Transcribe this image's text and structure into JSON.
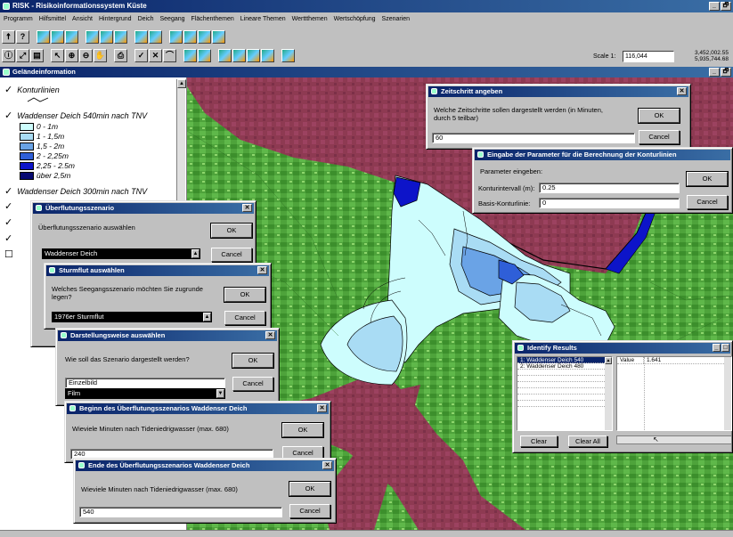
{
  "app": {
    "title": "RISK - Risikoinformationssystem Küste",
    "window_buttons": [
      "_",
      "🗗"
    ]
  },
  "menu": [
    "Programm",
    "Hilfsmittel",
    "Ansicht",
    "Hintergrund",
    "Deich",
    "Seegang",
    "Flächenthemen",
    "Lineare Themen",
    "Werttthemen",
    "Wertschöpfung",
    "Szenarien"
  ],
  "toolbar": {
    "scale_label": "Scale 1:",
    "scale_value": "116,044",
    "coord_x": "3,452,002.55",
    "coord_y": "5,935,744.68"
  },
  "subwindow": {
    "title": "Geländeinformation",
    "buttons": [
      "_",
      "🗗"
    ]
  },
  "legend": {
    "layer1": "Konturlinien",
    "layer2": "Waddenser Deich 540min nach TNV",
    "items": [
      {
        "label": "0 - 1m",
        "color": "#cdfdfd"
      },
      {
        "label": "1 - 1,5m",
        "color": "#a9dcf4"
      },
      {
        "label": "1,5 - 2m",
        "color": "#6aa3e6"
      },
      {
        "label": "2 - 2,25m",
        "color": "#2f5fd8"
      },
      {
        "label": "2,25 - 2.5m",
        "color": "#0d14c9"
      },
      {
        "label": "über 2,5m",
        "color": "#080a72"
      }
    ],
    "layer3": "Waddenser Deich 300min nach TNV"
  },
  "dialogs": {
    "zeitschritt": {
      "title": "Zeitschritt angeben",
      "text": "Welche Zeitschritte sollen dargestellt werden (in Minuten, durch 5 teilbar)",
      "value": "60",
      "ok": "OK",
      "cancel": "Cancel"
    },
    "konturparam": {
      "title": "Eingabe der Parameter für die Berechnung der Konturlinien",
      "text": "Parameter eingeben:",
      "label1": "Konturintervall (m):",
      "value1": "0.25",
      "label2": "Basis-Konturlinie:",
      "value2": "0",
      "ok": "OK",
      "cancel": "Cancel"
    },
    "ueberflutung": {
      "title": "Überflutungsszenario",
      "text": "Überflutungsszenario auswählen",
      "value": "Waddenser Deich",
      "ok": "OK",
      "cancel": "Cancel"
    },
    "sturmflut": {
      "title": "Sturmflut auswählen",
      "text": "Welches Seegangsszenario möchten Sie zugrunde legen?",
      "value": "1976er Sturmflut",
      "ok": "OK",
      "cancel": "Cancel"
    },
    "darstellung": {
      "title": "Darstellungsweise auswählen",
      "text": "Wie soll das Szenario dargestellt werden?",
      "value": "Einzelbild",
      "option": "Film",
      "ok": "OK",
      "cancel": "Cancel"
    },
    "beginn": {
      "title": "Beginn des Überflutungsszenarios Waddenser Deich",
      "text": "Wieviele Minuten nach Tideniedrigwasser (max. 680)",
      "value": "240",
      "ok": "OK",
      "cancel": "Cancel"
    },
    "ende": {
      "title": "Ende des Überflutungsszenarios Waddenser Deich",
      "text": "Wieviele Minuten nach Tideniedrigwasser (max. 680)",
      "value": "540",
      "ok": "OK",
      "cancel": "Cancel"
    },
    "identify": {
      "title": "Identify Results",
      "list": [
        "1: Waddenser Deich 540",
        "2: Waddenser Deich 480"
      ],
      "field_label": "Value",
      "field_value": "1.641",
      "clear": "Clear",
      "clear_all": "Clear All"
    }
  }
}
